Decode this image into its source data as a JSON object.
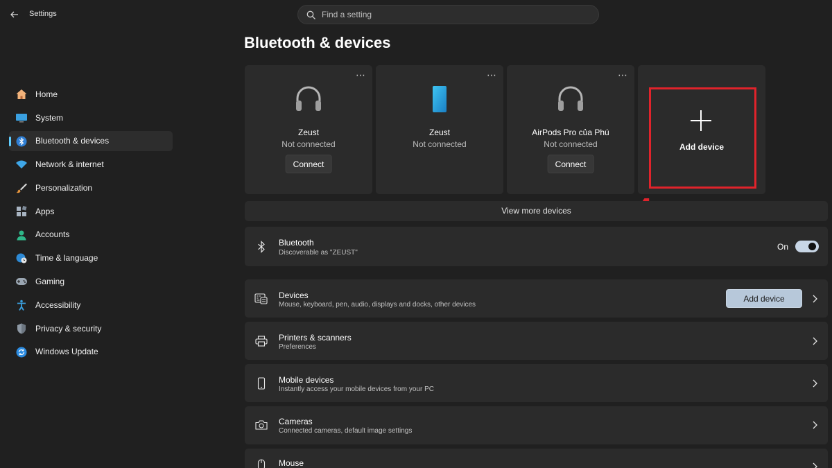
{
  "window": {
    "title": "Settings"
  },
  "search": {
    "placeholder": "Find a setting"
  },
  "nav": {
    "items": [
      {
        "label": "Home",
        "icon": "home-icon"
      },
      {
        "label": "System",
        "icon": "system-icon"
      },
      {
        "label": "Bluetooth & devices",
        "icon": "bluetooth-icon",
        "active": true
      },
      {
        "label": "Network & internet",
        "icon": "wifi-icon"
      },
      {
        "label": "Personalization",
        "icon": "brush-icon"
      },
      {
        "label": "Apps",
        "icon": "apps-icon"
      },
      {
        "label": "Accounts",
        "icon": "person-icon"
      },
      {
        "label": "Time & language",
        "icon": "globe-clock-icon"
      },
      {
        "label": "Gaming",
        "icon": "gamepad-icon"
      },
      {
        "label": "Accessibility",
        "icon": "accessibility-icon"
      },
      {
        "label": "Privacy & security",
        "icon": "shield-icon"
      },
      {
        "label": "Windows Update",
        "icon": "update-icon"
      }
    ]
  },
  "page": {
    "title": "Bluetooth & devices"
  },
  "device_cards": [
    {
      "name": "Zeust",
      "status": "Not connected",
      "button": "Connect",
      "icon": "headphones-icon"
    },
    {
      "name": "Zeust",
      "status": "Not connected",
      "icon": "phone-icon"
    },
    {
      "name": "AirPods Pro của Phú",
      "status": "Not connected",
      "button": "Connect",
      "icon": "headphones-icon"
    }
  ],
  "add_card": {
    "label": "Add device",
    "icon": "plus-icon"
  },
  "annotation": {
    "step_number": "4",
    "color": "#e0232b"
  },
  "view_more": {
    "label": "View more devices"
  },
  "bluetooth_row": {
    "title": "Bluetooth",
    "subtitle": "Discoverable as \"ZEUST\"",
    "toggle_label": "On",
    "toggle_on": true
  },
  "settings_rows": [
    {
      "title": "Devices",
      "subtitle": "Mouse, keyboard, pen, audio, displays and docks, other devices",
      "button": "Add device",
      "icon": "keyboard-devices-icon"
    },
    {
      "title": "Printers & scanners",
      "subtitle": "Preferences",
      "icon": "printer-icon"
    },
    {
      "title": "Mobile devices",
      "subtitle": "Instantly access your mobile devices from your PC",
      "icon": "mobile-icon"
    },
    {
      "title": "Cameras",
      "subtitle": "Connected cameras, default image settings",
      "icon": "camera-icon"
    },
    {
      "title": "Mouse",
      "subtitle": "",
      "icon": "mouse-icon"
    }
  ],
  "colors": {
    "accent": "#60cdff",
    "background": "#202020",
    "card": "#2b2b2b",
    "primary_button": "#b7c8da"
  }
}
